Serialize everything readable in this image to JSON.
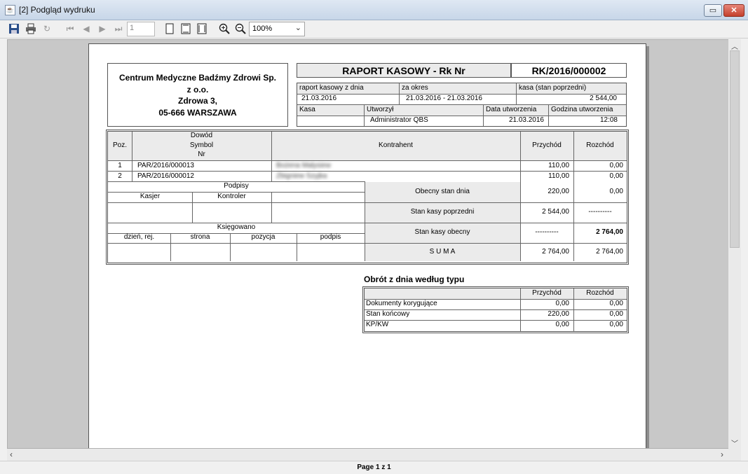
{
  "window": {
    "title": "[2] Podgląd wydruku"
  },
  "toolbar": {
    "page_value": "1",
    "zoom": "100%"
  },
  "status": {
    "page_info": "Page 1 z 1"
  },
  "report": {
    "company": {
      "name_line1": "Centrum Medyczne Badźmy Zdrowi Sp.",
      "name_line2": "z o.o.",
      "street": "Zdrowa 3,",
      "city": "05-666 WARSZAWA"
    },
    "title": "RAPORT KASOWY - Rk Nr",
    "number": "RK/2016/000002",
    "info": {
      "date_label": "raport kasowy z dnia",
      "date_value": "21.03.2016",
      "period_label": "za okres",
      "period_value": "21.03.2016 - 21.03.2016",
      "prev_label": "kasa (stan poprzedni)",
      "prev_value": "2 544,00",
      "kasa_label": "Kasa",
      "kasa_value": "",
      "created_by_label": "Utworzył",
      "created_by_value": "Administrator QBS",
      "created_date_label": "Data utworzenia",
      "created_date_value": "21.03.2016",
      "created_time_label": "Godzina utworzenia",
      "created_time_value": "12:08"
    },
    "table": {
      "col_poz": "Poz.",
      "col_dowod_1": "Dowód",
      "col_dowod_2": "Symbol",
      "col_dowod_3": "Nr",
      "col_kontrahent": "Kontrahent",
      "col_przychod": "Przychód",
      "col_rozchod": "Rozchód",
      "rows": [
        {
          "poz": "1",
          "symbol": "PAR/2016/000013",
          "kontrahent": "Bożena Malysiew",
          "przychod": "110,00",
          "rozchod": "0,00"
        },
        {
          "poz": "2",
          "symbol": "PAR/2016/000012",
          "kontrahent": "Zbigniew Szyjka",
          "przychod": "110,00",
          "rozchod": "0,00"
        }
      ]
    },
    "signatures": {
      "title": "Podpisy",
      "kasjer": "Kasjer",
      "kontroler": "Kontroler"
    },
    "booked": {
      "title": "Księgowano",
      "day": "dzień, rej.",
      "page": "strona",
      "position": "pozycja",
      "sign": "podpis"
    },
    "summary": [
      {
        "label": "Obecny stan dnia",
        "przychod": "220,00",
        "rozchod": "0,00"
      },
      {
        "label": "Stan kasy poprzedni",
        "przychod": "2 544,00",
        "rozchod": "----------"
      },
      {
        "label": "Stan kasy obecny",
        "przychod": "----------",
        "rozchod": "2 764,00"
      },
      {
        "label": "S U M A",
        "przychod": "2 764,00",
        "rozchod": "2 764,00"
      }
    ],
    "turnover": {
      "title": "Obrót z dnia według typu",
      "col_przychod": "Przychód",
      "col_rozchod": "Rozchód",
      "rows": [
        {
          "label": "Dokumenty korygujące",
          "przychod": "0,00",
          "rozchod": "0,00"
        },
        {
          "label": "Stan końcowy",
          "przychod": "220,00",
          "rozchod": "0,00"
        },
        {
          "label": "KP/KW",
          "przychod": "0,00",
          "rozchod": "0,00"
        }
      ]
    }
  }
}
